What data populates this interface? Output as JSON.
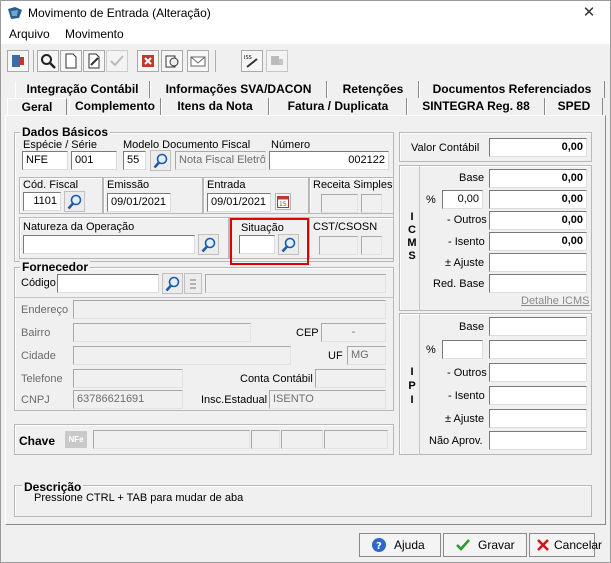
{
  "window": {
    "title": "Movimento de Entrada (Alteração)",
    "close_glyph": "✕"
  },
  "menu": {
    "items": [
      "Arquivo",
      "Movimento"
    ]
  },
  "tabs": {
    "row1": [
      "Integração Contábil",
      "Informações SVA/DACON",
      "Retenções",
      "Documentos Referenciados"
    ],
    "row2": [
      "Geral",
      "Complemento",
      "Itens da Nota",
      "Fatura / Duplicata",
      "SINTEGRA Reg. 88",
      "SPED"
    ]
  },
  "dados_basicos": {
    "title": "Dados Básicos",
    "especie_label": "Espécie / Série",
    "especie_value": "NFE",
    "serie_value": "001",
    "modelo_label": "Modelo Documento Fiscal",
    "modelo_code": "55",
    "modelo_desc": "Nota Fiscal Eletrôn",
    "numero_label": "Número",
    "numero_value": "002122",
    "cod_fiscal_label": "Cód. Fiscal",
    "cod_fiscal_value": "1101",
    "emissao_label": "Emissão",
    "emissao_value": "09/01/2021",
    "entrada_label": "Entrada",
    "entrada_value": "09/01/2021",
    "receita_label": "Receita Simples",
    "natureza_label": "Natureza da Operação",
    "natureza_value": "",
    "situacao_label": "Situação",
    "situacao_value": "",
    "cst_label": "CST/CSOSN"
  },
  "fornecedor": {
    "title": "Fornecedor",
    "codigo_label": "Código",
    "endereco_label": "Endereço",
    "bairro_label": "Bairro",
    "cep_label": "CEP",
    "cep_value": "-",
    "cidade_label": "Cidade",
    "uf_label": "UF",
    "uf_value": "MG",
    "telefone_label": "Telefone",
    "conta_label": "Conta Contábil",
    "cnpj_label": "CNPJ",
    "cnpj_value": "63786621691",
    "insc_label": "Insc.Estadual",
    "insc_value": "ISENTO"
  },
  "chave": {
    "label": "Chave",
    "icon_text": "NFe"
  },
  "valor_contabil": {
    "label": "Valor Contábil",
    "value": "0,00"
  },
  "icms": {
    "vertical": "ICMS",
    "base_label": "Base",
    "base_value": "0,00",
    "pct_label": "%",
    "pct_value": "0,00",
    "pct_result": "0,00",
    "outros_label": "- Outros",
    "outros_value": "0,00",
    "isento_label": "- Isento",
    "isento_value": "0,00",
    "ajuste_label": "± Ajuste",
    "red_label": "Red. Base",
    "detalhe_link": "Detalhe ICMS"
  },
  "ipi": {
    "vertical": "IPI",
    "base_label": "Base",
    "pct_label": "%",
    "outros_label": "- Outros",
    "isento_label": "- Isento",
    "ajuste_label": "± Ajuste",
    "naoaprov_label": "Não Aprov."
  },
  "descricao": {
    "title": "Descrição",
    "text": "Pressione CTRL + TAB para  mudar de aba"
  },
  "buttons": {
    "ajuda": "Ajuda",
    "gravar": "Gravar",
    "cancelar": "Cancelar"
  },
  "colors": {
    "highlight": "#e00000",
    "accent": "#1c5aa8"
  }
}
